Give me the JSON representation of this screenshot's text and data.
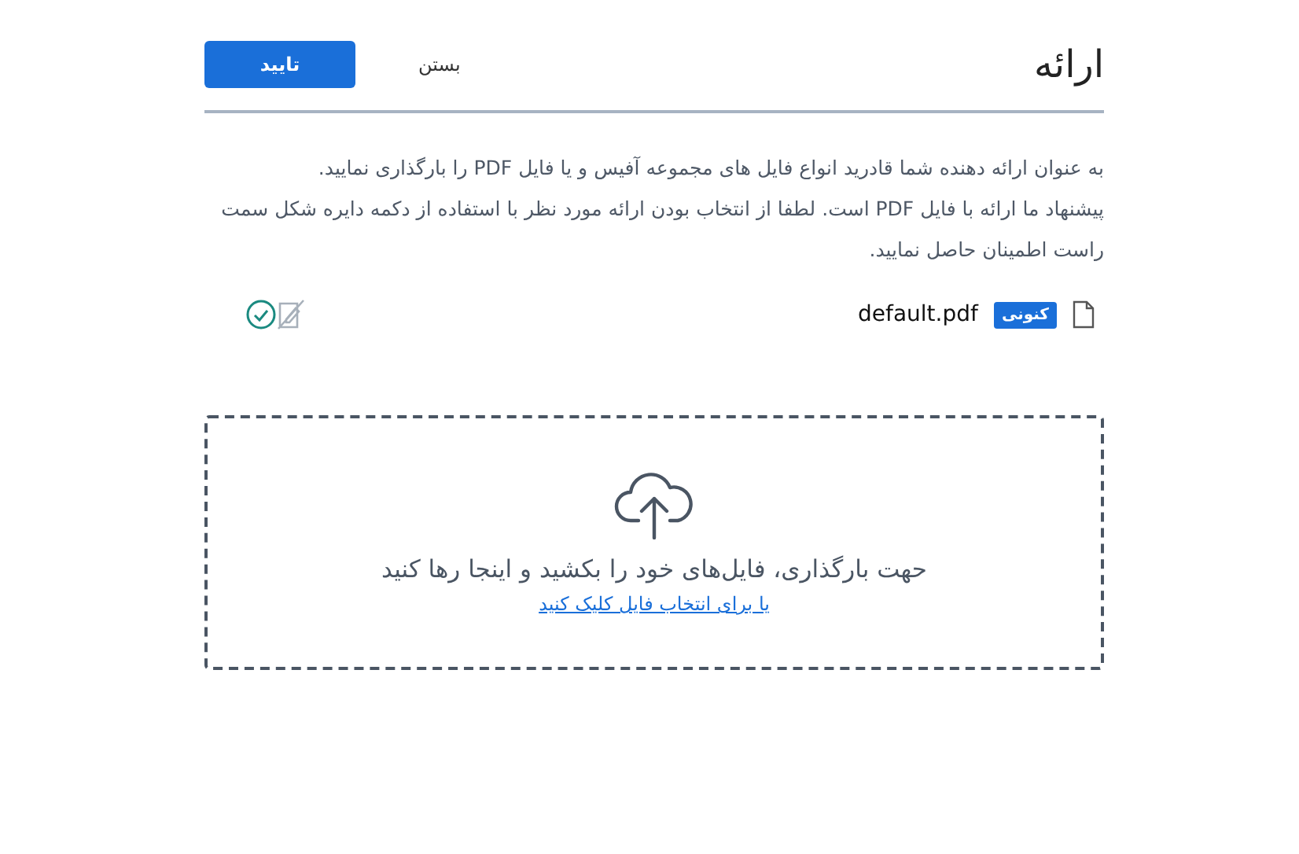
{
  "dialog": {
    "title": "ارائه",
    "buttons": [
      {
        "label": "بستن",
        "kind": "text"
      },
      {
        "label": "تایید",
        "kind": "primary"
      }
    ]
  },
  "description": [
    "به عنوان ارائه دهنده شما قادرید انواع فایل های مجموعه آفیس و یا فایل PDF را بارگذاری نمایید.",
    "پیشنهاد ما ارائه با فایل PDF است. لطفا از انتخاب بودن ارائه مورد نظر با استفاده از دکمه دایره شکل سمت راست اطمینان حاصل نمایید."
  ],
  "files": [
    {
      "name": "default.pdf",
      "badge": "کنونی",
      "selected": true
    }
  ],
  "dropzone": {
    "message": "حهت بارگذاری، فایل‌های خود را بکشید و اینجا رها کنید",
    "link": "یا برای انتخاب فایل کلیک کنید"
  }
}
